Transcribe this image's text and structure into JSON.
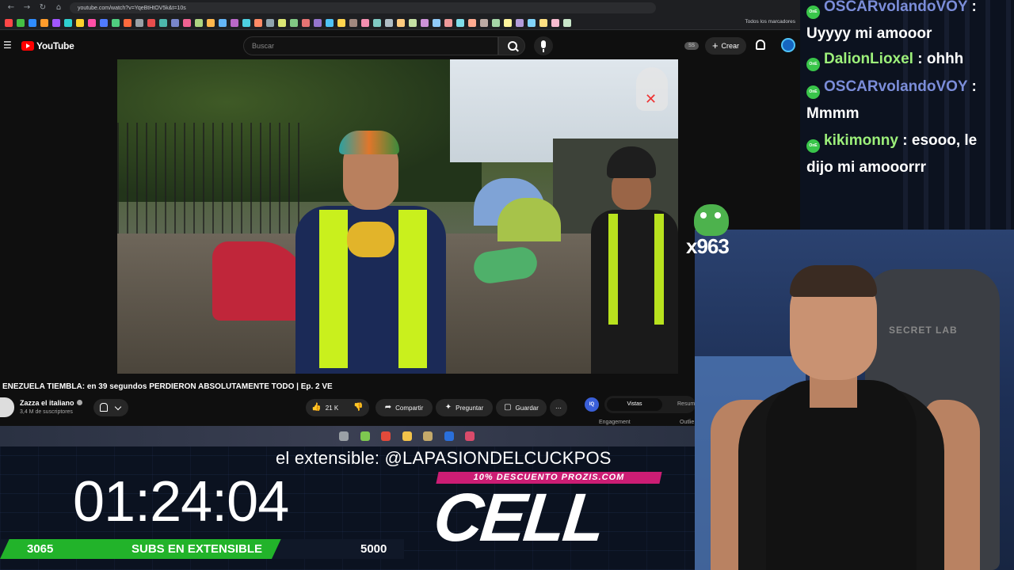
{
  "browser": {
    "url": "youtube.com/watch?v=YqeBtHtOV5k&t=10s",
    "bookmarks_all": "Todos los marcadores",
    "bookmark_colors": [
      "#ff4747",
      "#45c145",
      "#2f8cff",
      "#ff9c2c",
      "#a056ff",
      "#2fd0d0",
      "#ffd12c",
      "#ff4fa8",
      "#4f7bff",
      "#4fce7f",
      "#ff6a3d",
      "#9aa0a6",
      "#e84d4d",
      "#4db6ac",
      "#7986cb",
      "#f06292",
      "#aed581",
      "#ffb74d",
      "#64b5f6",
      "#ba68c8",
      "#4dd0e1",
      "#ff8a65",
      "#90a4ae",
      "#dce775",
      "#81c784",
      "#e57373",
      "#9575cd",
      "#4fc3f7",
      "#ffd54f",
      "#a1887f",
      "#f48fb1",
      "#80cbc4",
      "#b0bec5",
      "#ffcc80",
      "#c5e1a5",
      "#ce93d8",
      "#90caf9",
      "#ef9a9a",
      "#80deea",
      "#ffab91",
      "#bcaaa4",
      "#a5d6a7",
      "#fff59d",
      "#b39ddb",
      "#81d4fa",
      "#ffe082",
      "#f8bbd0",
      "#c8e6c9"
    ]
  },
  "youtube": {
    "logo": "YouTube",
    "search_placeholder": "Buscar",
    "ss_badge": "SS",
    "create_label": "Crear",
    "video_title": "ENEZUELA TIEMBLA: en 39 segundos PERDIERON ABSOLUTAMENTE TODO | Ep. 2 VE",
    "channel_name": "Zazza el italiano",
    "channel_subs": "3,4 M de suscriptores",
    "likes": "21 K",
    "share_label": "Compartir",
    "ask_label": "Preguntar",
    "save_label": "Guardar",
    "ext_icon": "IQ",
    "ext_tab_active": "Vistas",
    "ext_tab2": "Resum",
    "ext_engagement": "Engagement",
    "ext_outlier": "Outlie"
  },
  "taskbar": {
    "icon_colors": [
      "#9aa0a6",
      "#7ec850",
      "#e24a3b",
      "#f3c34a",
      "#c4a96a",
      "#2a6fdb",
      "#d94b6b"
    ]
  },
  "stream": {
    "marquee": "el extensible: @LAPASIONDELCUCKPOS",
    "promo": "10% DESCUENTO PROZIS.COM",
    "cell_logo": "CELL",
    "timer": "01:24:04",
    "goal_current": "3065",
    "goal_label": "SUBS EN EXTENSIBLE",
    "goal_max": "5000",
    "goal_progress": 0.613,
    "emote_count": "x963"
  },
  "chat": {
    "messages": [
      {
        "user": "OSCARvolandoVOY",
        "text": "Uyyyy mi amooor",
        "color": "blue",
        "badge": "OnE"
      },
      {
        "user": "DalionLioxel",
        "text": "ohhh",
        "color": "green",
        "badge": "OnE"
      },
      {
        "user": "OSCARvolandoVOY",
        "text": "Mmmm",
        "color": "blue",
        "badge": "OnE"
      },
      {
        "user": "kikimonny",
        "text": "esooo, le dijo mi amooorrr",
        "color": "green",
        "badge": "OnE"
      }
    ]
  },
  "webcam": {
    "chair_logo": "SECRET LAB"
  }
}
